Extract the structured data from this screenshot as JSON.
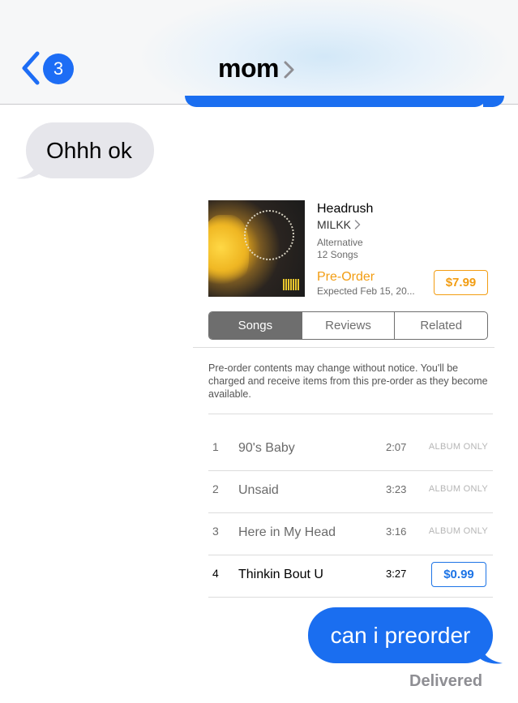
{
  "header": {
    "back_badge_count": "3",
    "contact_name": "mom",
    "accent_color": "#1d6df5"
  },
  "messages": {
    "incoming_text": "Ohhh ok",
    "outgoing_text": "can i preorder",
    "status": "Delivered"
  },
  "album": {
    "title": "Headrush",
    "artist": "MILKK",
    "genre": "Alternative",
    "song_count": "12 Songs",
    "preorder_label": "Pre-Order",
    "expected": "Expected Feb 15, 20...",
    "price": "$7.99",
    "tabs": [
      "Songs",
      "Reviews",
      "Related"
    ],
    "active_tab": "Songs",
    "notice": "Pre-order contents may change without notice. You'll be charged and receive items from this pre-order as they become available.",
    "tracks": [
      {
        "num": "1",
        "name": "90's Baby",
        "duration": "2:07",
        "tag": "ALBUM ONLY"
      },
      {
        "num": "2",
        "name": "Unsaid",
        "duration": "3:23",
        "tag": "ALBUM ONLY"
      },
      {
        "num": "3",
        "name": "Here in My Head",
        "duration": "3:16",
        "tag": "ALBUM ONLY"
      },
      {
        "num": "4",
        "name": "Thinkin Bout U",
        "duration": "3:27",
        "price": "$0.99"
      }
    ],
    "preorder_color": "#f29d12",
    "buy_color": "#1d74e6"
  },
  "icons": {
    "back": "chevron-left-icon",
    "contact_details": "chevron-right-icon",
    "artist_link": "chevron-right-icon"
  }
}
